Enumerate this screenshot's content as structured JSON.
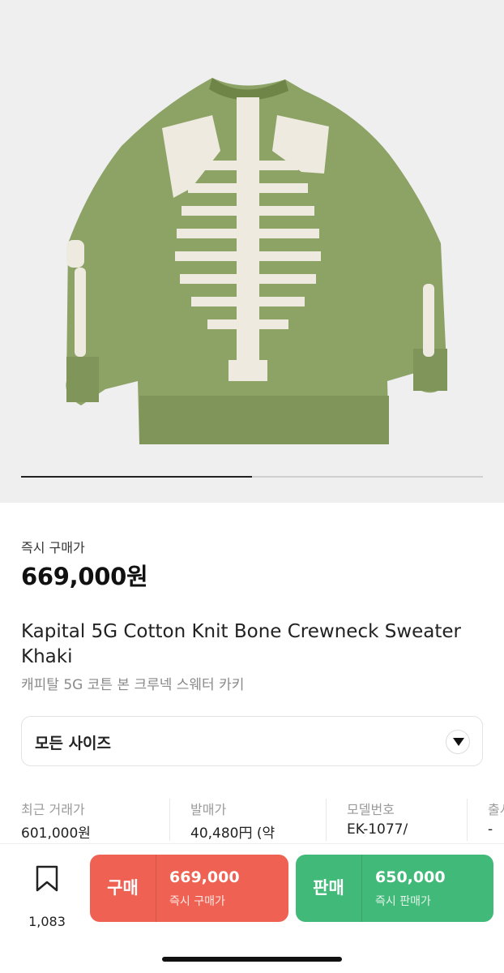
{
  "gallery": {
    "image_label": "Kapital 5G Cotton Knit Bone Crewneck Sweater Khaki",
    "progress": 0.5
  },
  "price": {
    "label": "즉시 구매가",
    "value": "669,000원"
  },
  "product": {
    "title_en": "Kapital 5G Cotton Knit Bone Crewneck Sweater Khaki",
    "title_ko": "캐피탈 5G 코튼 본 크루넥 스웨터 카키"
  },
  "size_selector": {
    "label": "모든 사이즈",
    "icon": "chevron-down-icon"
  },
  "stats": [
    {
      "label": "최근 거래가",
      "value": "601,000원"
    },
    {
      "label": "발매가",
      "value": "40,480円 (약"
    },
    {
      "label": "모델번호",
      "value": "EK-1077/"
    },
    {
      "label": "출시",
      "value": "-"
    }
  ],
  "bottom_bar": {
    "wish_count": "1,083",
    "wish_icon": "bookmark-icon",
    "buy": {
      "label": "구매",
      "price": "669,000",
      "sub": "즉시 구매가",
      "color": "#ef6253"
    },
    "sell": {
      "label": "판매",
      "price": "650,000",
      "sub": "즉시 판매가",
      "color": "#41b979"
    }
  }
}
